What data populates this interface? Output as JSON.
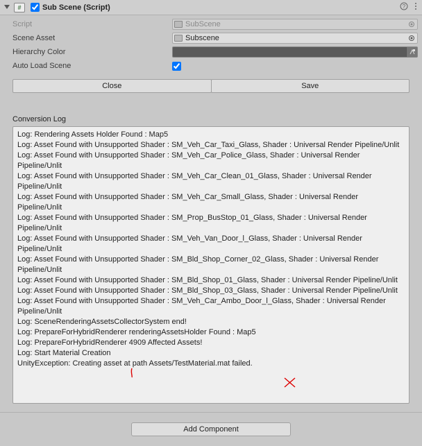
{
  "header": {
    "title": "Sub Scene (Script)",
    "enabled": true
  },
  "fields": {
    "script_label": "Script",
    "script_value": "SubScene",
    "scene_asset_label": "Scene Asset",
    "scene_asset_value": "Subscene",
    "hierarchy_color_label": "Hierarchy Color",
    "auto_load_label": "Auto Load Scene",
    "auto_load_checked": true
  },
  "buttons": {
    "close": "Close",
    "save": "Save",
    "add_component": "Add Component"
  },
  "log": {
    "title": "Conversion Log",
    "lines": [
      "Log: Rendering Assets Holder Found : Map5",
      "Log: Asset Found with Unsupported Shader : SM_Veh_Car_Taxi_Glass, Shader : Universal Render Pipeline/Unlit",
      "Log: Asset Found with Unsupported Shader : SM_Veh_Car_Police_Glass, Shader : Universal Render Pipeline/Unlit",
      "Log: Asset Found with Unsupported Shader : SM_Veh_Car_Clean_01_Glass, Shader : Universal Render Pipeline/Unlit",
      "Log: Asset Found with Unsupported Shader : SM_Veh_Car_Small_Glass, Shader : Universal Render Pipeline/Unlit",
      "Log: Asset Found with Unsupported Shader : SM_Prop_BusStop_01_Glass, Shader : Universal Render Pipeline/Unlit",
      "Log: Asset Found with Unsupported Shader : SM_Veh_Van_Door_l_Glass, Shader : Universal Render Pipeline/Unlit",
      "Log: Asset Found with Unsupported Shader : SM_Bld_Shop_Corner_02_Glass, Shader : Universal Render Pipeline/Unlit",
      "Log: Asset Found with Unsupported Shader : SM_Bld_Shop_01_Glass, Shader : Universal Render Pipeline/Unlit",
      "Log: Asset Found with Unsupported Shader : SM_Bld_Shop_03_Glass, Shader : Universal Render Pipeline/Unlit",
      "Log: Asset Found with Unsupported Shader : SM_Veh_Car_Ambo_Door_l_Glass, Shader : Universal Render Pipeline/Unlit",
      "Log: SceneRenderingAssetsCollectorSystem end!",
      "Log: PrepareForHybridRenderer renderingAssetsHolder Found : Map5",
      "Log: PrepareForHybridRenderer 4909 Affected Assets!",
      "Log: Start Material Creation",
      "UnityException: Creating asset at path Assets/TestMaterial.mat failed."
    ]
  },
  "annotations": {
    "mark1": "",
    "mark2": ""
  }
}
